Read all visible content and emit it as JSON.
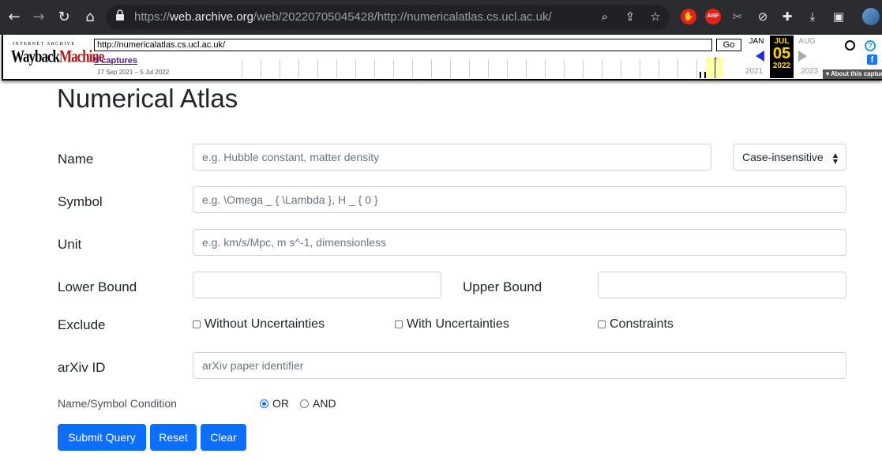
{
  "browser": {
    "url_host": "web.archive.org",
    "url_prefix": "https://",
    "url_path": "/web/20220705045428/http://numericalatlas.cs.ucl.ac.uk/",
    "icons": [
      "back-arrow-icon",
      "forward-arrow-icon",
      "reload-icon",
      "home-icon",
      "lock-icon",
      "zoom-icon",
      "share-icon",
      "star-icon",
      "extension-stop-icon",
      "adblock-icon",
      "extension-scissors-icon",
      "extension-block-icon",
      "puzzle-icon",
      "download-icon",
      "sidepanel-icon",
      "profile-avatar-icon"
    ],
    "abp_label": "ABP"
  },
  "wayback": {
    "logo_small": "INTERNET ARCHIVE",
    "logo_left": "Wayback",
    "logo_right": "Machine",
    "url_value": "http://numericalatlas.cs.ucl.ac.uk/",
    "go_label": "Go",
    "captures_label": "5 captures",
    "capture_range": "17 Sep 2021 – 5 Jul 2022",
    "prev_month": "JAN",
    "cur_month": "JUL",
    "next_month": "AUG",
    "day": "05",
    "prev_year": "2021",
    "cur_year": "2022",
    "next_year": "2023",
    "help_label": "?",
    "fb_label": "f",
    "about_label": "▾ About this capture"
  },
  "page": {
    "title": "Numerical Atlas"
  },
  "form": {
    "name_label": "Name",
    "name_placeholder": "e.g. Hubble constant, matter density",
    "case_select": "Case-insensitive",
    "symbol_label": "Symbol",
    "symbol_placeholder": "e.g. \\Omega _ { \\Lambda }, H _ { 0 }",
    "unit_label": "Unit",
    "unit_placeholder": "e.g. km/s/Mpc, m s^-1, dimensionless",
    "lower_label": "Lower Bound",
    "upper_label": "Upper Bound",
    "exclude_label": "Exclude",
    "exclude_options": [
      "Without Uncertainties",
      "With Uncertainties",
      "Constraints"
    ],
    "arxiv_label": "arXiv ID",
    "arxiv_placeholder": "arXiv paper identifier",
    "condition_label": "Name/Symbol Condition",
    "condition_options": [
      "OR",
      "AND"
    ],
    "condition_selected": "OR",
    "submit_label": "Submit Query",
    "reset_label": "Reset",
    "clear_label": "Clear"
  },
  "colors": {
    "primary": "#0d6efd",
    "wayback_red": "#ab1b1b",
    "chrome_bg": "#2b2c30"
  }
}
